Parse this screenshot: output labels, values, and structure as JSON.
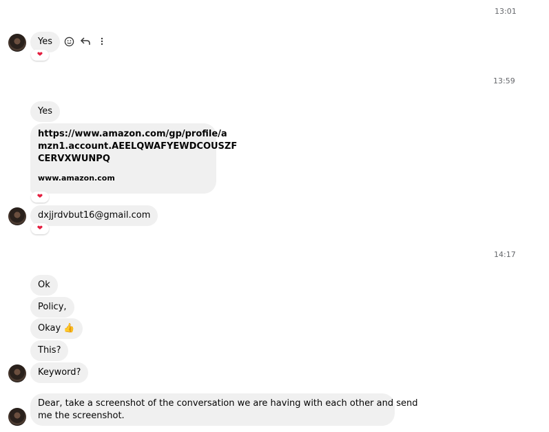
{
  "timestamps": [
    "13:01",
    "13:59",
    "14:17"
  ],
  "messages": {
    "m1": "Yes",
    "m2": "Yes",
    "link": {
      "url_line1": "https://www.amazon.com/gp/profile/a",
      "url_line2": "mzn1.account.AEELQWAFYEWDCOUSZF",
      "url_line3": "CERVXWUNPQ",
      "domain": "www.amazon.com"
    },
    "m3": "dxjjrdvbut16@gmail.com",
    "m4": "Ok",
    "m5": "Policy,",
    "m6": "Okay 👍",
    "m7": "This?",
    "m8": "Keyword?",
    "m9_line1": "Dear, take a screenshot of the conversation we are having with each other and send",
    "m9_line2": "me the screenshot."
  },
  "reaction": "heart",
  "icons": [
    "smiley-icon",
    "reply-icon",
    "more-icon"
  ],
  "colors": {
    "bubble": "#f0f0f0",
    "heart": "#e41e3f",
    "timestamp": "#65676b"
  }
}
